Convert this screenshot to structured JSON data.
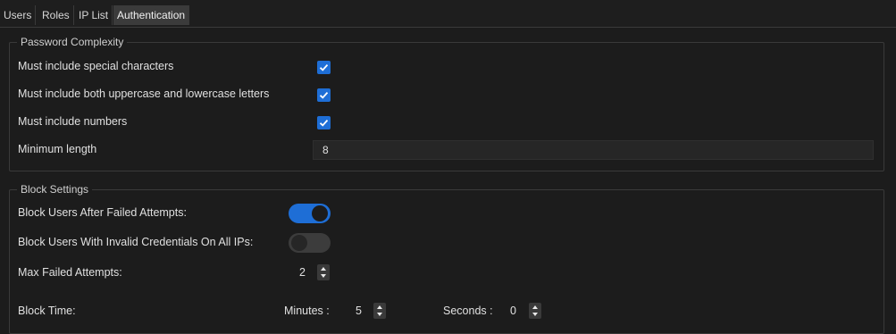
{
  "tabs": [
    "Users",
    "Roles",
    "IP List",
    "Authentication"
  ],
  "password_complexity": {
    "title": "Password Complexity",
    "special_chars": {
      "label": "Must include special characters",
      "checked": true
    },
    "mixed_case": {
      "label": "Must include both uppercase and lowercase letters",
      "checked": true
    },
    "numbers": {
      "label": "Must include numbers",
      "checked": true
    },
    "min_length": {
      "label": "Minimum length",
      "value": "8"
    }
  },
  "block_settings": {
    "title": "Block Settings",
    "block_failed": {
      "label": "Block Users After Failed Attempts:",
      "on": true
    },
    "block_invalid": {
      "label": "Block Users With Invalid Credentials On All IPs:",
      "on": false
    },
    "max_failed": {
      "label": "Max Failed Attempts:",
      "value": "2"
    },
    "block_time": {
      "label": "Block Time:",
      "minutes_label": "Minutes :",
      "minutes_value": "5",
      "seconds_label": "Seconds :",
      "seconds_value": "0"
    }
  },
  "colors": {
    "accent": "#1e6ed6",
    "background": "#1c1c1c"
  }
}
